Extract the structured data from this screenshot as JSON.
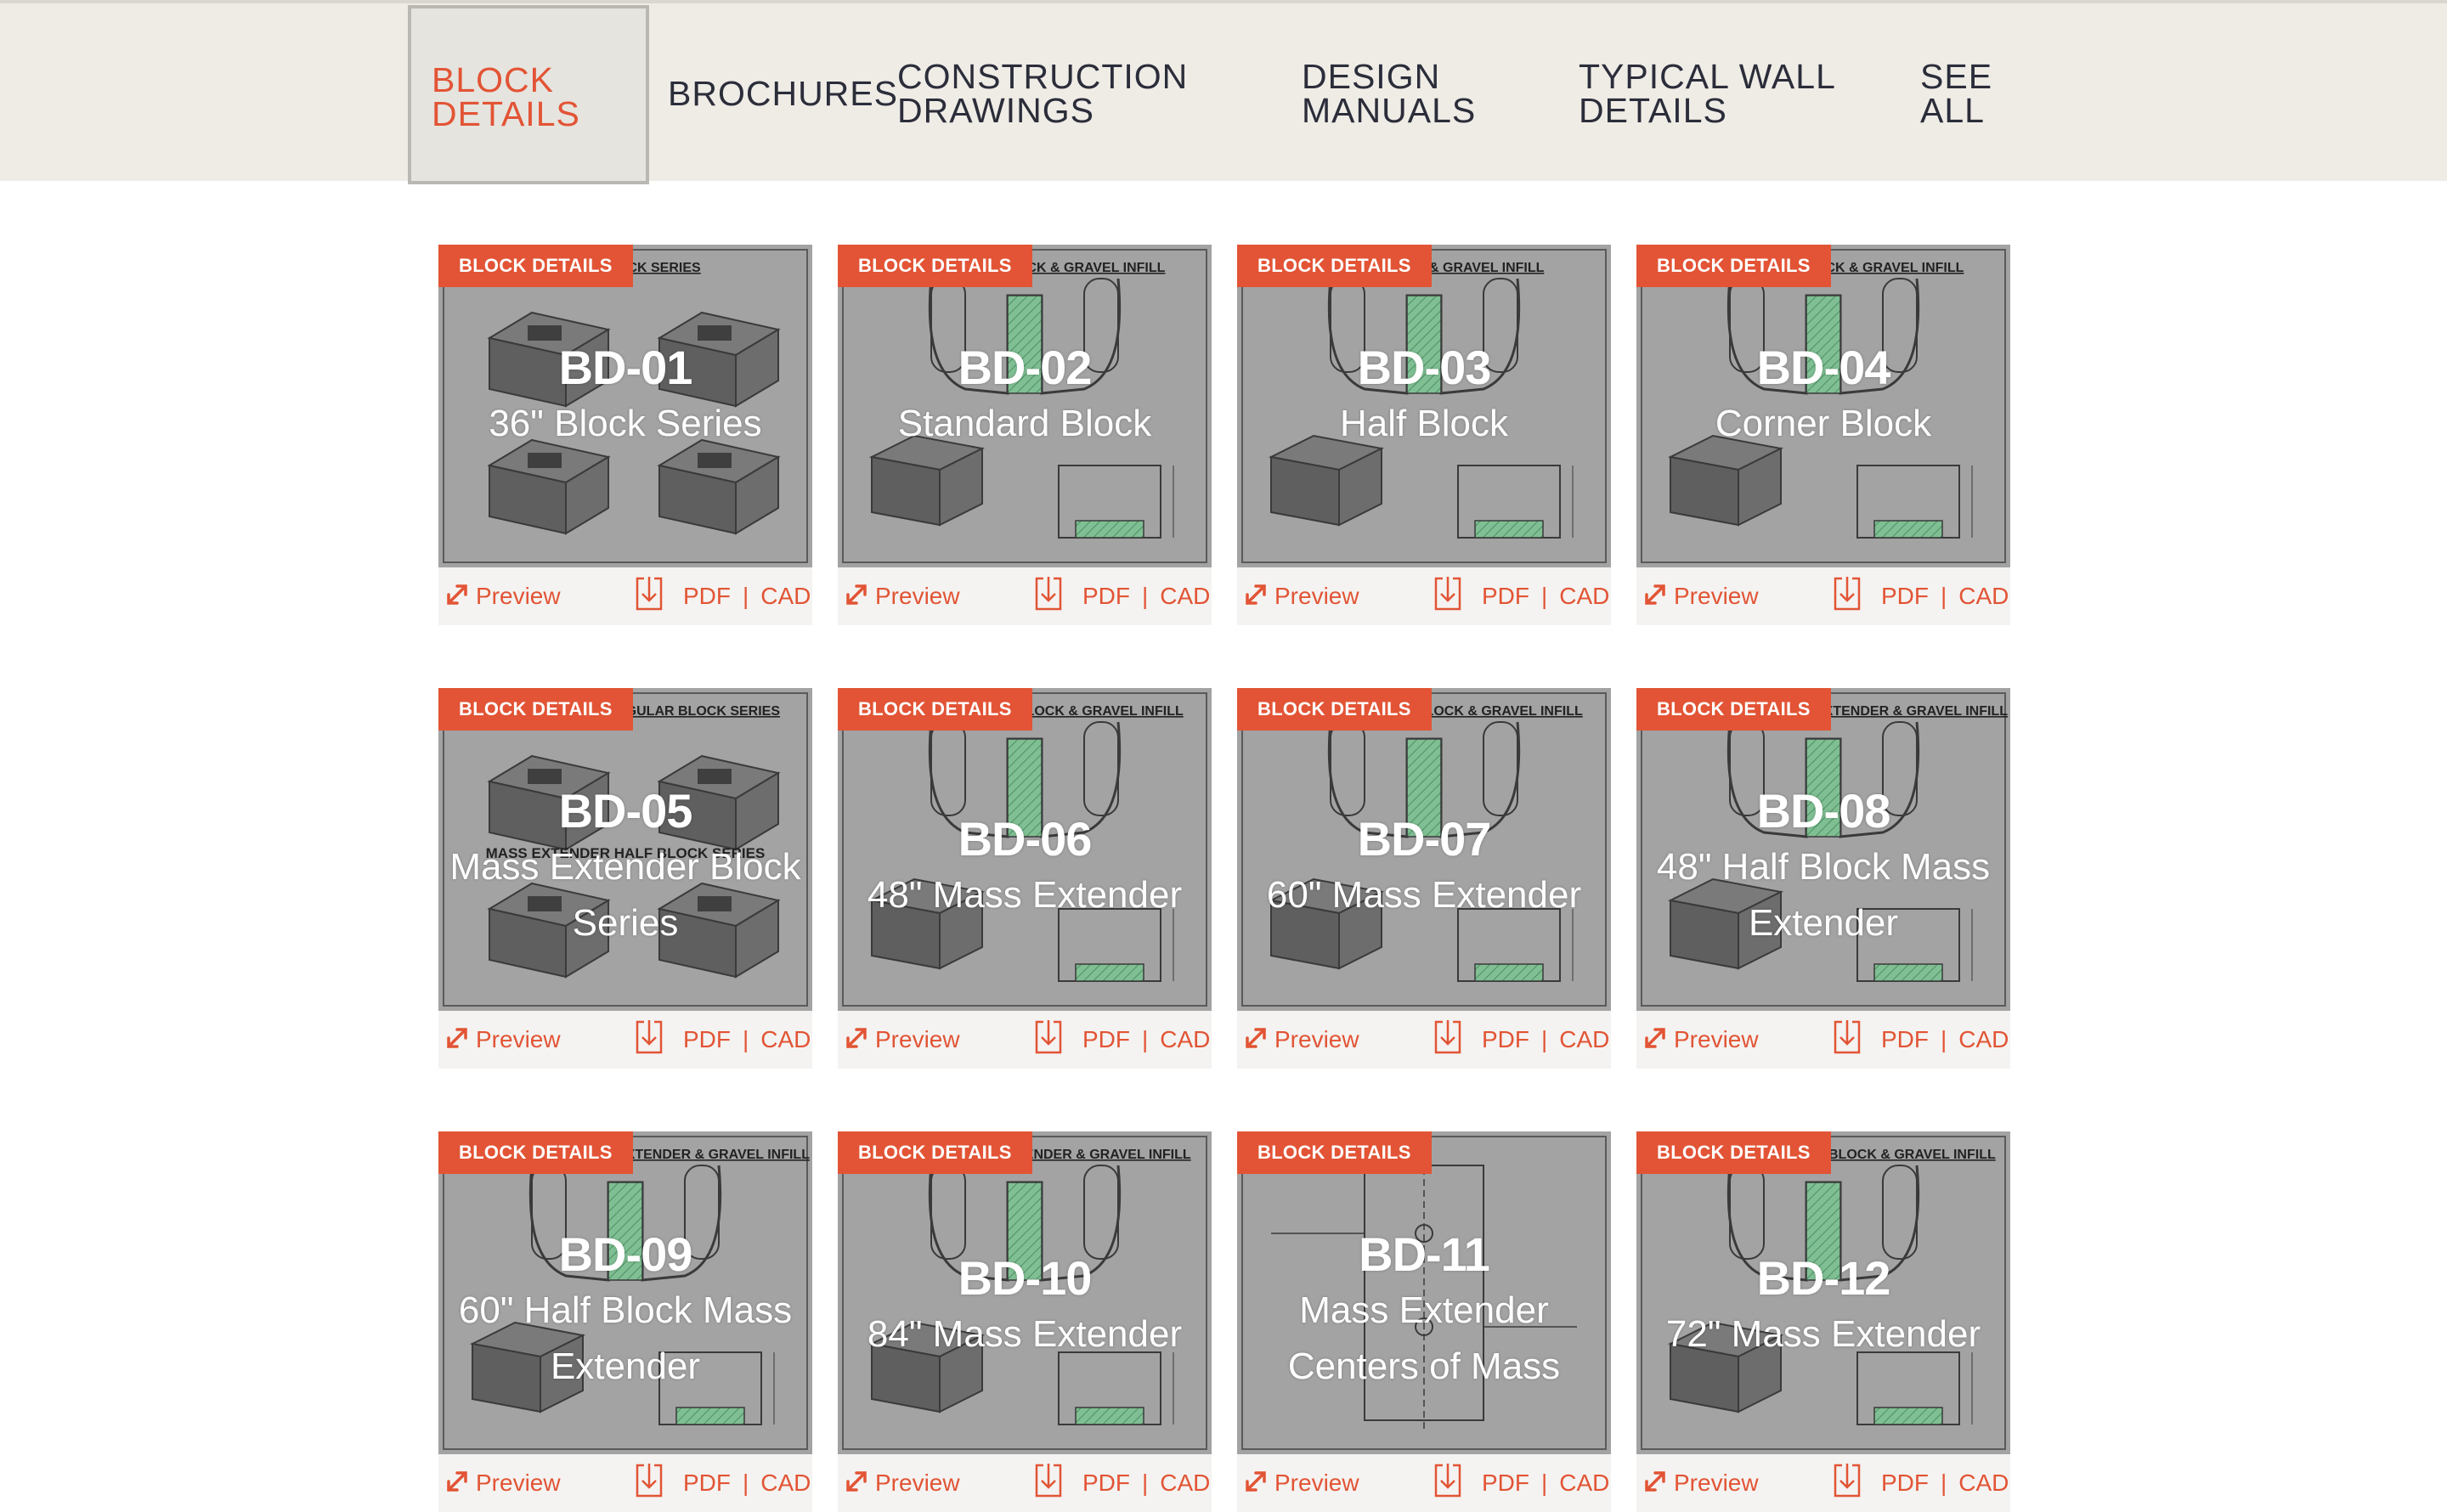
{
  "nav": {
    "items": [
      {
        "lines": [
          "BLOCK",
          "DETAILS"
        ],
        "active": true
      },
      {
        "lines": [
          "BROCHURES"
        ],
        "active": false
      },
      {
        "lines": [
          "CONSTRUCTION",
          "DRAWINGS"
        ],
        "active": false
      },
      {
        "lines": [
          "DESIGN",
          "MANUALS"
        ],
        "active": false
      },
      {
        "lines": [
          "TYPICAL WALL",
          "DETAILS"
        ],
        "active": false
      },
      {
        "lines": [
          "SEE",
          "ALL"
        ],
        "active": false
      }
    ]
  },
  "colors": {
    "accent": "#e25435",
    "nav_bg": "#efece6",
    "nav_text": "#2b2d3a",
    "thumb_bg": "#a3a3a3",
    "hatch": "#7fbf93"
  },
  "card_labels": {
    "badge": "BLOCK DETAILS",
    "preview": "Preview",
    "pdf": "PDF",
    "separator": "|",
    "cad": "CAD"
  },
  "cards": [
    {
      "code": "BD-01",
      "title": "36\" Block Series",
      "header": "OCK SERIES",
      "drawing": "blocks"
    },
    {
      "code": "BD-02",
      "title": "Standard Block",
      "header": "OCK & GRAVEL INFILL",
      "drawing": "infill"
    },
    {
      "code": "BD-03",
      "title": "Half Block",
      "header": "K & GRAVEL INFILL",
      "drawing": "infill"
    },
    {
      "code": "BD-04",
      "title": "Corner Block",
      "header": "OCK & GRAVEL INFILL",
      "drawing": "corner"
    },
    {
      "code": "BD-05",
      "title": "Mass Extender Block Series",
      "header": "EGULAR BLOCK SERIES",
      "subheader": "MASS EXTENDER HALF BLOCK SERIES",
      "drawing": "blocks"
    },
    {
      "code": "BD-06",
      "title": "48\" Mass Extender",
      "header": "BLOCK & GRAVEL INFILL",
      "drawing": "infill"
    },
    {
      "code": "BD-07",
      "title": "60\" Mass Extender",
      "header": "BLOCK & GRAVEL INFILL",
      "drawing": "infill"
    },
    {
      "code": "BD-08",
      "title": "48\" Half Block Mass Extender",
      "header": "EXTENDER & GRAVEL INFILL",
      "drawing": "infill"
    },
    {
      "code": "BD-09",
      "title": "60\" Half Block Mass Extender",
      "header": "EXTENDER & GRAVEL INFILL",
      "drawing": "infill"
    },
    {
      "code": "BD-10",
      "title": "84\" Mass Extender",
      "header": "TENDER & GRAVEL INFILL",
      "drawing": "infill"
    },
    {
      "code": "BD-11",
      "title": "Mass Extender Centers of Mass",
      "header": "",
      "drawing": "centers"
    },
    {
      "code": "BD-12",
      "title": "72\" Mass Extender",
      "header": "R BLOCK & GRAVEL INFILL",
      "drawing": "infill"
    }
  ]
}
